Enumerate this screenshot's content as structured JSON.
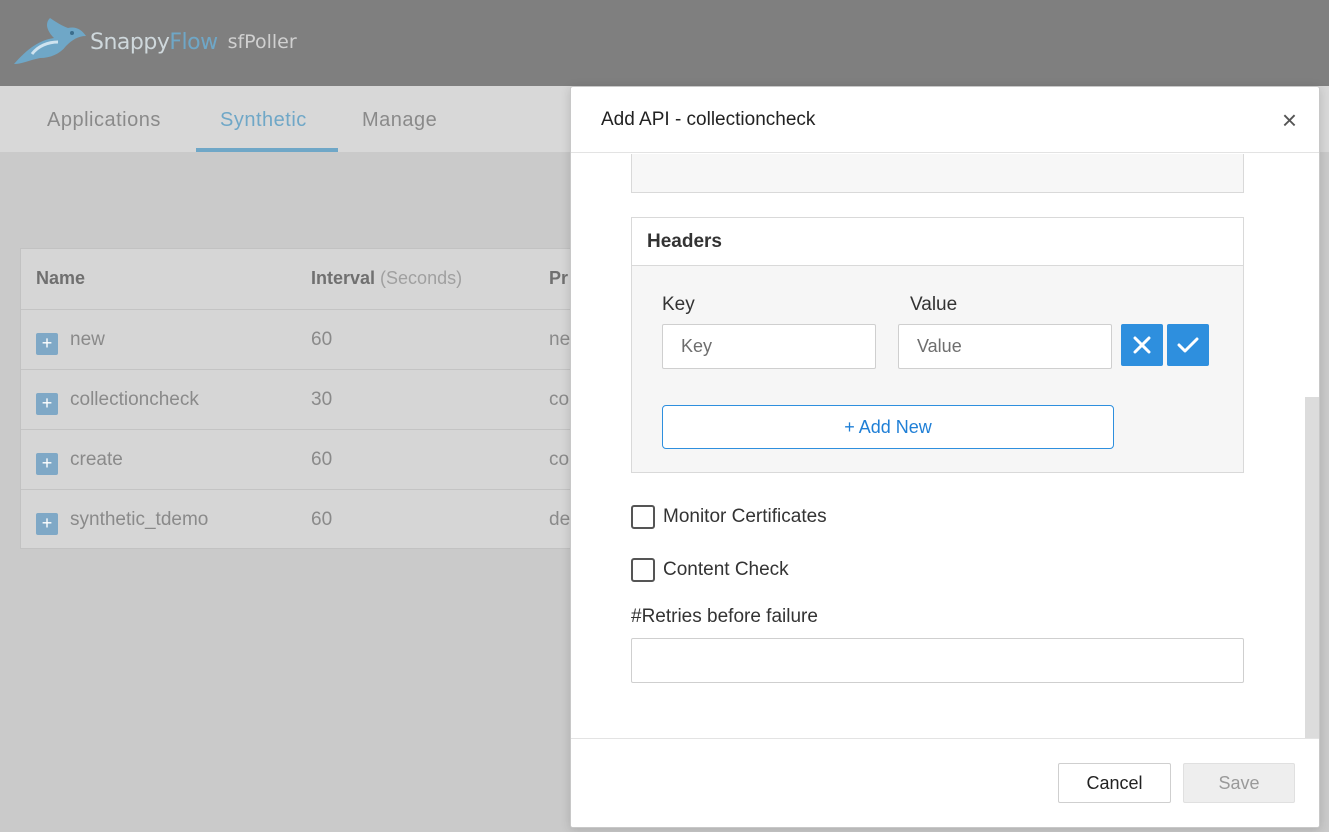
{
  "app": {
    "logo_text_snappy": "Snappy",
    "logo_text_flow": "Flow",
    "logo_subtitle": "sfPoller"
  },
  "tabs": [
    {
      "label": "Applications",
      "active": false
    },
    {
      "label": "Synthetic",
      "active": true
    },
    {
      "label": "Manage",
      "active": false
    }
  ],
  "table": {
    "columns": {
      "name": "Name",
      "interval": "Interval",
      "interval_unit": "(Seconds)",
      "third": "Pr"
    },
    "rows": [
      {
        "name": "new",
        "interval": "60",
        "third": "ne"
      },
      {
        "name": "collectioncheck",
        "interval": "30",
        "third": "co"
      },
      {
        "name": "create",
        "interval": "60",
        "third": "co"
      },
      {
        "name": "synthetic_tdemo",
        "interval": "60",
        "third": "de"
      }
    ],
    "expand_symbol": "+"
  },
  "modal": {
    "title": "Add API - collectioncheck",
    "close_symbol": "×",
    "headers": {
      "title": "Headers",
      "key_label": "Key",
      "value_label": "Value",
      "key_placeholder": "Key",
      "value_placeholder": "Value",
      "add_new_label": "+ Add New"
    },
    "monitor_certificates_label": "Monitor Certificates",
    "content_check_label": "Content Check",
    "retries_label": "#Retries before failure",
    "cancel_label": "Cancel",
    "save_label": "Save"
  },
  "colors": {
    "accent": "#2e8fde",
    "tab_active": "#6fa7c7",
    "topbar": "#7f7f7f"
  },
  "icons": [
    "snappyflow-logo",
    "plus-icon",
    "close-icon",
    "cancel-x-icon",
    "confirm-check-icon"
  ]
}
